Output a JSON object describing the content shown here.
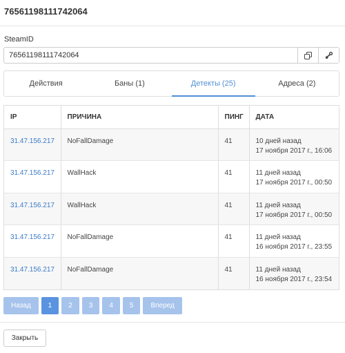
{
  "header": {
    "title": "76561198111742064"
  },
  "steamid": {
    "label": "SteamID",
    "value": "76561198111742064",
    "copy_icon": "copy-icon",
    "steam_icon": "steam-logo-icon"
  },
  "tabs": [
    {
      "label": "Действия",
      "active": false
    },
    {
      "label": "Баны (1)",
      "active": false
    },
    {
      "label": "Детекты (25)",
      "active": true
    },
    {
      "label": "Адреса (2)",
      "active": false
    }
  ],
  "table": {
    "columns": [
      "IP",
      "ПРИЧИНА",
      "ПИНГ",
      "ДАТА"
    ],
    "rows": [
      {
        "ip": "31.47.156.217",
        "reason": "NoFallDamage",
        "ping": "41",
        "date_rel": "10 дней назад",
        "date_abs": "17 ноября 2017 г., 16:06"
      },
      {
        "ip": "31.47.156.217",
        "reason": "WallHack",
        "ping": "41",
        "date_rel": "11 дней назад",
        "date_abs": "17 ноября 2017 г., 00:50"
      },
      {
        "ip": "31.47.156.217",
        "reason": "WallHack",
        "ping": "41",
        "date_rel": "11 дней назад",
        "date_abs": "17 ноября 2017 г., 00:50"
      },
      {
        "ip": "31.47.156.217",
        "reason": "NoFallDamage",
        "ping": "41",
        "date_rel": "11 дней назад",
        "date_abs": "16 ноября 2017 г., 23:55"
      },
      {
        "ip": "31.47.156.217",
        "reason": "NoFallDamage",
        "ping": "41",
        "date_rel": "11 дней назад",
        "date_abs": "16 ноября 2017 г., 23:54"
      }
    ]
  },
  "pagination": {
    "prev": "Назад",
    "pages": [
      "1",
      "2",
      "3",
      "4",
      "5"
    ],
    "current": "1",
    "next": "Вперед"
  },
  "footer": {
    "close_label": "Закрыть"
  },
  "colors": {
    "accent": "#4f8fd6",
    "link": "#3a7bc8",
    "pager": "#a6c3ec",
    "pager_active": "#5a93e0"
  }
}
